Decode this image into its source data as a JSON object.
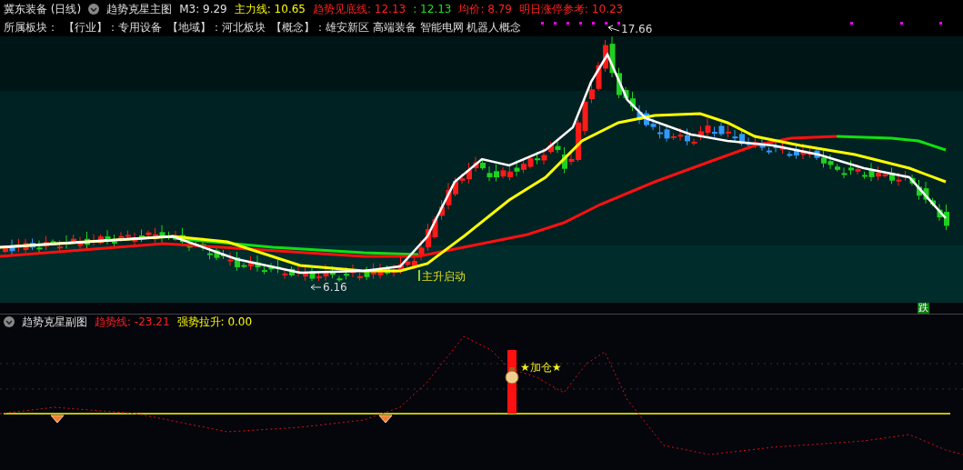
{
  "header": {
    "stock": "冀东装备 (日线)",
    "indicator": "趋势克星主图",
    "values": [
      {
        "label": "M3:",
        "value": "9.29",
        "color": "#e0e0e0"
      },
      {
        "label": "主力线:",
        "value": "10.65",
        "color": "#ffff00"
      },
      {
        "label": "趋势见底线:",
        "value": "12.13",
        "color": "#ff2020"
      },
      {
        "label": ":",
        "value": "12.13",
        "color": "#20e020"
      },
      {
        "label": "均价:",
        "value": "8.79",
        "color": "#ff2020"
      },
      {
        "label": "明日涨停参考:",
        "value": "10.23",
        "color": "#ff2020"
      }
    ]
  },
  "sectors": {
    "label": "所属板块：",
    "items": [
      "【行业】：专用设备",
      "【地域】：河北板块",
      "【概念】：雄安新区 高端装备 智能电网 机器人概念"
    ]
  },
  "main_chart": {
    "annotations": [
      {
        "kind": "high",
        "text": "17.66"
      },
      {
        "kind": "low",
        "text": "6.16"
      },
      {
        "kind": "signal",
        "text": "主升启动"
      }
    ],
    "badge": "跌"
  },
  "sub_chart": {
    "title": "趋势克星副图",
    "values": [
      {
        "label": "趋势线:",
        "value": "-23.21",
        "color": "#ff2020"
      },
      {
        "label": "强势拉升:",
        "value": "0.00",
        "color": "#ffff00"
      }
    ],
    "signal": "★加仓★"
  }
}
